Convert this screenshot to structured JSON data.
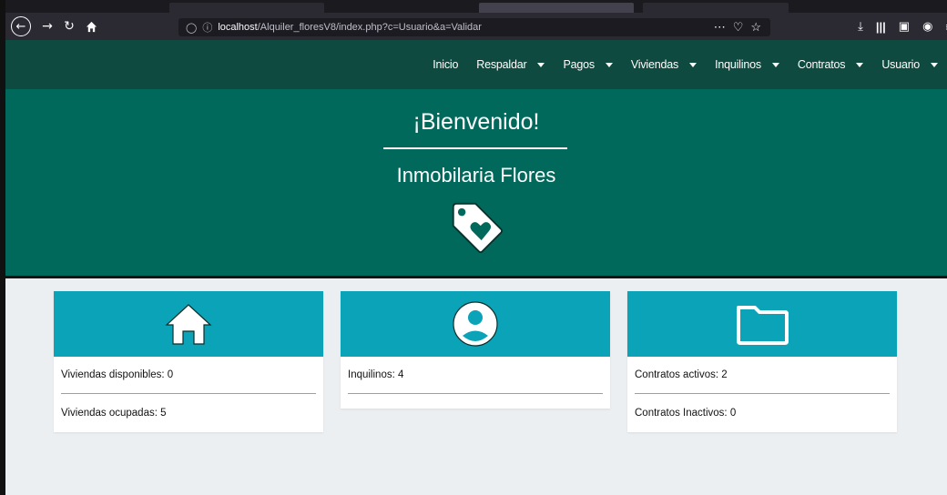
{
  "browser": {
    "url_host": "localhost",
    "url_path": "/Alquiler_floresV8/index.php?c=Usuario&a=Validar",
    "page_actions": "⋯",
    "pocket_glyph": "♡",
    "bookmark_glyph": "☆"
  },
  "navbar": {
    "items": [
      {
        "label": "Inicio",
        "dropdown": false
      },
      {
        "label": "Respaldar",
        "dropdown": true
      },
      {
        "label": "Pagos",
        "dropdown": true
      },
      {
        "label": "Viviendas",
        "dropdown": true
      },
      {
        "label": "Inquilinos",
        "dropdown": true
      },
      {
        "label": "Contratos",
        "dropdown": true
      },
      {
        "label": "Usuario",
        "dropdown": true
      }
    ]
  },
  "hero": {
    "title": "¡Bienvenido!",
    "subtitle": "Inmobilaria Flores"
  },
  "cards": {
    "viviendas": {
      "line1": "Viviendas disponibles: 0",
      "line2": "Viviendas ocupadas: 5"
    },
    "inquilinos": {
      "line1": "Inquilinos: 4"
    },
    "contratos": {
      "line1": "Contratos activos: 2",
      "line2": "Contratos Inactivos: 0"
    }
  },
  "colors": {
    "navbar": "#0e4a3f",
    "hero": "#00695c",
    "card_header": "#0aa3b8",
    "background": "#eceff1"
  }
}
